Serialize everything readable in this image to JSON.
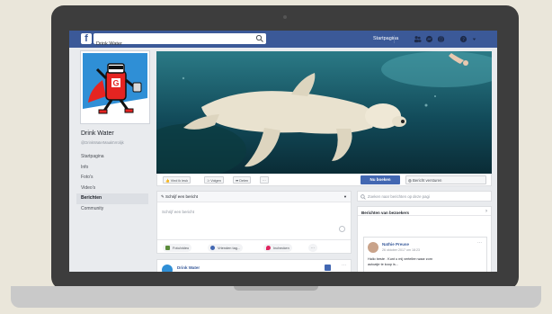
{
  "topbar": {
    "logo_letter": "f",
    "search_value": "Drink Water",
    "home_label": "Startpagina",
    "brand_color": "#3b5998"
  },
  "page": {
    "name": "Drink Water",
    "handle": "@DrinkWaterMaaktVrolijk"
  },
  "left_nav": {
    "items": [
      "Startpagina",
      "Info",
      "Foto's",
      "Video's",
      "Berichten",
      "Community"
    ],
    "active_index": 4
  },
  "actions": {
    "like": "Vind ik leuk",
    "follow": "Volgen",
    "share": "Delen",
    "more": "···",
    "book": "Nu boeken",
    "message": "Bericht versturen"
  },
  "composer": {
    "header": "Schrijf een bericht",
    "placeholder": "Schrijf een bericht",
    "tools": [
      "Foto/video",
      "Vrienden tag...",
      "Inchecken",
      "···"
    ]
  },
  "feed": {
    "first_post_name": "Drink Water"
  },
  "right": {
    "search_placeholder": "Zoeken naar berichten op deze pagi",
    "visitors_title": "Berichten van bezoekers",
    "visitor_name": "Nathie Preuse",
    "visitor_date": "26 oktober 2017 om 18:23",
    "visitor_text_1": "Hallo beste . Kunt u mij vertellen waar zorn",
    "visitor_text_2": "autoatje te koop is..."
  },
  "colors": {
    "accent": "#4267b2",
    "page_bg": "#e9ebee"
  }
}
